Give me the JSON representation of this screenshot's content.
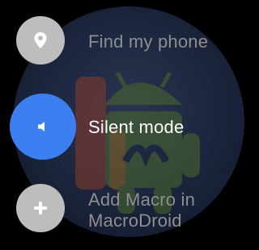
{
  "app": {
    "background_color": "#000000",
    "face_color": "#1b243c"
  },
  "items": [
    {
      "label": "Find my phone",
      "icon": "location-pin-icon",
      "state": "dimmed"
    },
    {
      "label": "Silent mode",
      "icon": "speaker-icon",
      "state": "selected",
      "accent": "#3b7ff0"
    },
    {
      "label_line1": "Add Macro in",
      "label_line2": "MacroDroid",
      "icon": "plus-icon",
      "state": "dimmed"
    }
  ],
  "colors": {
    "accent": "#3b7ff0",
    "inactive_circle": "#bdbdbd",
    "inactive_text": "#8e8e8e",
    "active_text": "#ffffff"
  }
}
